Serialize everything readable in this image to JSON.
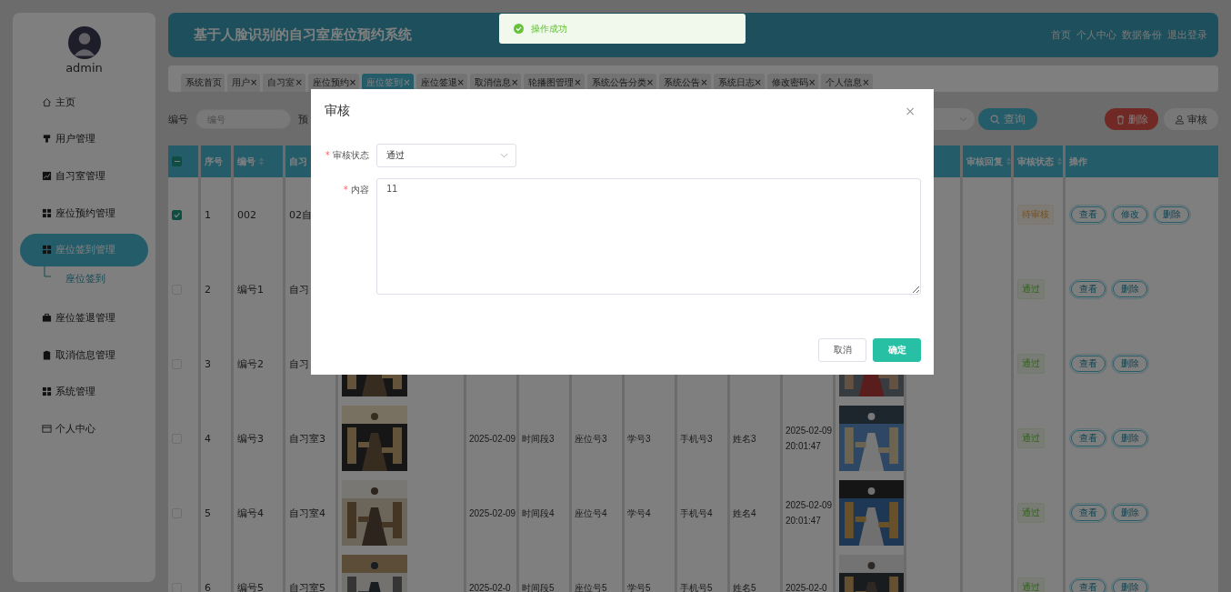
{
  "sidebar": {
    "user": "admin",
    "items": [
      {
        "label": "主页",
        "selected": false
      },
      {
        "label": "用户管理",
        "selected": false
      },
      {
        "label": "自习室管理",
        "selected": false
      },
      {
        "label": "座位预约管理",
        "selected": false
      },
      {
        "label": "座位签到管理",
        "selected": true,
        "children": [
          {
            "label": "座位签到",
            "selected": true
          }
        ]
      },
      {
        "label": "座位签退管理",
        "selected": false
      },
      {
        "label": "取消信息管理",
        "selected": false
      },
      {
        "label": "系统管理",
        "selected": false
      },
      {
        "label": "个人中心",
        "selected": false
      }
    ]
  },
  "header": {
    "title": "基于人脸识别的自习室座位预约系统",
    "links": [
      "首页",
      "个人中心",
      "数据备份",
      "退出登录"
    ]
  },
  "tabs": [
    {
      "label": "系统首页",
      "selected": false
    },
    {
      "label": "用户",
      "close": "×",
      "selected": false
    },
    {
      "label": "自习室",
      "close": "×",
      "selected": false
    },
    {
      "label": "座位预约",
      "close": "×",
      "selected": false
    },
    {
      "label": "座位签到",
      "close": "×",
      "selected": true
    },
    {
      "label": "座位签退",
      "close": "×",
      "selected": false
    },
    {
      "label": "取消信息",
      "close": "×",
      "selected": false
    },
    {
      "label": "轮播图管理",
      "close": "×",
      "selected": false
    },
    {
      "label": "系统公告分类",
      "close": "×",
      "selected": false
    },
    {
      "label": "系统公告",
      "close": "×",
      "selected": false
    },
    {
      "label": "系统日志",
      "close": "×",
      "selected": false
    },
    {
      "label": "修改密码",
      "close": "×",
      "selected": false
    },
    {
      "label": "个人信息",
      "close": "×",
      "selected": false
    }
  ],
  "search": {
    "label": "编号",
    "placeholder": "编号",
    "label_2": "预",
    "query_button": "查询",
    "delete_button": "删除",
    "audit_button": "审核"
  },
  "table": {
    "header_checkbox": {
      "indeterminate": true
    },
    "columns": [
      {
        "label": "序号"
      },
      {
        "label": "编号",
        "sortable": true
      },
      {
        "label": "自习"
      },
      {},
      {},
      {},
      {},
      {},
      {},
      {},
      {},
      {},
      {},
      {
        "label": "审核回复",
        "sortable": true
      },
      {
        "label": "审核状态",
        "sortable": true
      },
      {
        "label": "操作"
      }
    ],
    "rows": [
      {
        "checked": true,
        "index": "1",
        "code": "002",
        "room": "02自",
        "status": {
          "label": "待审核",
          "kind": "pending"
        },
        "actions": [
          "查看",
          "修改",
          "删除"
        ]
      },
      {
        "checked": false,
        "index": "2",
        "code": "编号1",
        "room": "自习",
        "status": {
          "label": "通过",
          "kind": "passed"
        },
        "actions": [
          "查看",
          "删除"
        ]
      },
      {
        "checked": false,
        "index": "3",
        "code": "编号2",
        "room": "自习",
        "picture": {
          "kind": "picture"
        },
        "photo": {
          "kind": "picture"
        },
        "status": {
          "label": "通过",
          "kind": "passed"
        },
        "actions": [
          "查看",
          "删除"
        ]
      },
      {
        "checked": false,
        "index": "4",
        "code": "编号3",
        "room": "自习室3",
        "picture": {
          "kind": "picture"
        },
        "date": "2025-02-09",
        "time_slot": "时间段3",
        "seat": "座位号3",
        "student_id": "学号3",
        "phone": "手机号3",
        "name": "姓名3",
        "sign_time": "2025-02-09 20:01:47",
        "photo": {
          "kind": "picture"
        },
        "status": {
          "label": "通过",
          "kind": "passed"
        },
        "actions": [
          "查看",
          "删除"
        ]
      },
      {
        "checked": false,
        "index": "5",
        "code": "编号4",
        "room": "自习室4",
        "picture": {
          "kind": "picture"
        },
        "date": "2025-02-09",
        "time_slot": "时间段4",
        "seat": "座位号4",
        "student_id": "学号4",
        "phone": "手机号4",
        "name": "姓名4",
        "sign_time": "2025-02-09 20:01:47",
        "photo": {
          "kind": "picture"
        },
        "status": {
          "label": "通过",
          "kind": "passed"
        },
        "actions": [
          "查看",
          "删除"
        ]
      },
      {
        "checked": false,
        "index": "6",
        "code": "编号5",
        "room": "自习室5",
        "picture": {
          "kind": "picture"
        },
        "date": "2025-02-0",
        "time_slot": "时间段5",
        "seat": "座位号5",
        "student_id": "学号5",
        "phone": "手机号5",
        "name": "姓名5",
        "sign_time": "2025-02-0",
        "photo": {
          "kind": "picture"
        },
        "status": {
          "label": "通过",
          "kind": "passed"
        },
        "actions": [
          "查看",
          "删除"
        ]
      }
    ]
  },
  "dialog": {
    "title": "审核",
    "close": "×",
    "fields": [
      {
        "kind": "select",
        "label": "审核状态",
        "required": "*",
        "value": "通过"
      },
      {
        "kind": "textarea",
        "label": "内容",
        "required": "*",
        "value": "11"
      }
    ],
    "buttons": [
      {
        "label": "取消",
        "kind": "default"
      },
      {
        "label": "确定",
        "kind": "primary"
      }
    ]
  },
  "toast": {
    "message": "操作成功",
    "kind": "success"
  }
}
